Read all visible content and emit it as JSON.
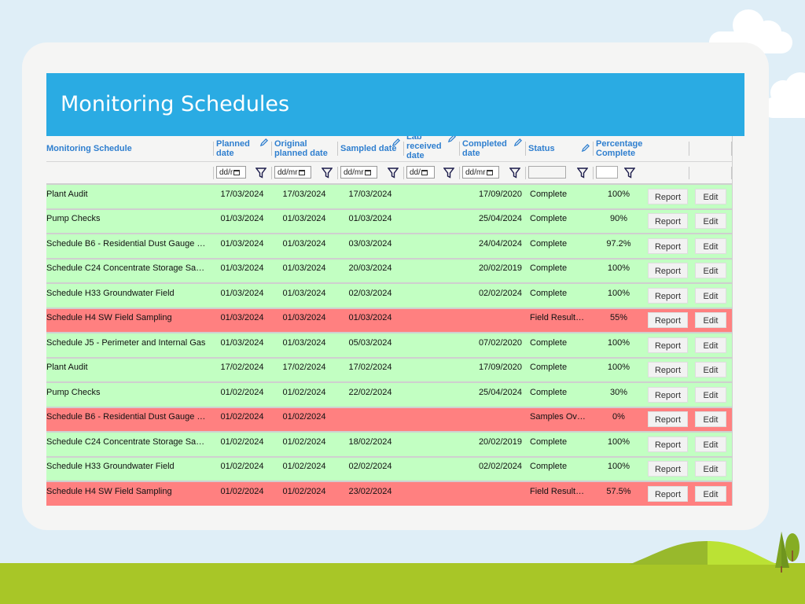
{
  "page": {
    "title": "Monitoring Schedules"
  },
  "colors": {
    "banner": "#2aabe3",
    "header_text": "#2f7fcf",
    "row_ok": "#c2ffc2",
    "row_alert": "#ff8080"
  },
  "columns": [
    {
      "label": "Monitoring Schedule",
      "editable": false
    },
    {
      "label": "Planned date",
      "editable": true
    },
    {
      "label": "Original planned date",
      "editable": false
    },
    {
      "label": "Sampled date",
      "editable": true
    },
    {
      "label": "Lab received date",
      "editable": true
    },
    {
      "label": "Completed date",
      "editable": true
    },
    {
      "label": "Status",
      "editable": true
    },
    {
      "label": "Percentage Complete",
      "editable": false
    },
    {
      "label": "",
      "editable": false
    },
    {
      "label": "",
      "editable": false
    }
  ],
  "filters": {
    "planned_date": "dd/r",
    "original_planned_date": "dd/mr",
    "sampled_date": "dd/mr",
    "lab_received_date": "dd/",
    "completed_date": "dd/mr",
    "status": "",
    "percentage": ""
  },
  "buttons": {
    "report": "Report",
    "edit": "Edit"
  },
  "rows": [
    {
      "name": "Plant Audit",
      "planned": "17/03/2024",
      "original": "17/03/2024",
      "sampled": "17/03/2024",
      "lab": "",
      "completed": "17/09/2020",
      "status": "Complete",
      "pct": "100%",
      "state": "ok"
    },
    {
      "name": "Pump Checks",
      "planned": "01/03/2024",
      "original": "01/03/2024",
      "sampled": "01/03/2024",
      "lab": "",
      "completed": "25/04/2024",
      "status": "Complete",
      "pct": "90%",
      "state": "ok"
    },
    {
      "name": "Schedule B6 - Residential Dust Gauge …",
      "planned": "01/03/2024",
      "original": "01/03/2024",
      "sampled": "03/03/2024",
      "lab": "",
      "completed": "24/04/2024",
      "status": "Complete",
      "pct": "97.2%",
      "state": "ok"
    },
    {
      "name": "Schedule C24 Concentrate Storage Sa…",
      "planned": "01/03/2024",
      "original": "01/03/2024",
      "sampled": "20/03/2024",
      "lab": "",
      "completed": "20/02/2019",
      "status": "Complete",
      "pct": "100%",
      "state": "ok"
    },
    {
      "name": "Schedule H33 Groundwater Field",
      "planned": "01/03/2024",
      "original": "01/03/2024",
      "sampled": "02/03/2024",
      "lab": "",
      "completed": "02/02/2024",
      "status": "Complete",
      "pct": "100%",
      "state": "ok"
    },
    {
      "name": "Schedule H4 SW Field Sampling",
      "planned": "01/03/2024",
      "original": "01/03/2024",
      "sampled": "01/03/2024",
      "lab": "",
      "completed": "",
      "status": "Field Result…",
      "pct": "55%",
      "state": "bad"
    },
    {
      "name": "Schedule J5 - Perimeter and Internal Gas",
      "planned": "01/03/2024",
      "original": "01/03/2024",
      "sampled": "05/03/2024",
      "lab": "",
      "completed": "07/02/2020",
      "status": "Complete",
      "pct": "100%",
      "state": "ok"
    },
    {
      "name": "Plant Audit",
      "planned": "17/02/2024",
      "original": "17/02/2024",
      "sampled": "17/02/2024",
      "lab": "",
      "completed": "17/09/2020",
      "status": "Complete",
      "pct": "100%",
      "state": "ok"
    },
    {
      "name": "Pump Checks",
      "planned": "01/02/2024",
      "original": "01/02/2024",
      "sampled": "22/02/2024",
      "lab": "",
      "completed": "25/04/2024",
      "status": "Complete",
      "pct": "30%",
      "state": "ok"
    },
    {
      "name": "Schedule B6 - Residential Dust Gauge …",
      "planned": "01/02/2024",
      "original": "01/02/2024",
      "sampled": "",
      "lab": "",
      "completed": "",
      "status": "Samples Ov…",
      "pct": "0%",
      "state": "bad"
    },
    {
      "name": "Schedule C24 Concentrate Storage Sa…",
      "planned": "01/02/2024",
      "original": "01/02/2024",
      "sampled": "18/02/2024",
      "lab": "",
      "completed": "20/02/2019",
      "status": "Complete",
      "pct": "100%",
      "state": "ok"
    },
    {
      "name": "Schedule H33 Groundwater Field",
      "planned": "01/02/2024",
      "original": "01/02/2024",
      "sampled": "02/02/2024",
      "lab": "",
      "completed": "02/02/2024",
      "status": "Complete",
      "pct": "100%",
      "state": "ok"
    },
    {
      "name": "Schedule H4 SW Field Sampling",
      "planned": "01/02/2024",
      "original": "01/02/2024",
      "sampled": "23/02/2024",
      "lab": "",
      "completed": "",
      "status": "Field Result…",
      "pct": "57.5%",
      "state": "bad"
    }
  ]
}
